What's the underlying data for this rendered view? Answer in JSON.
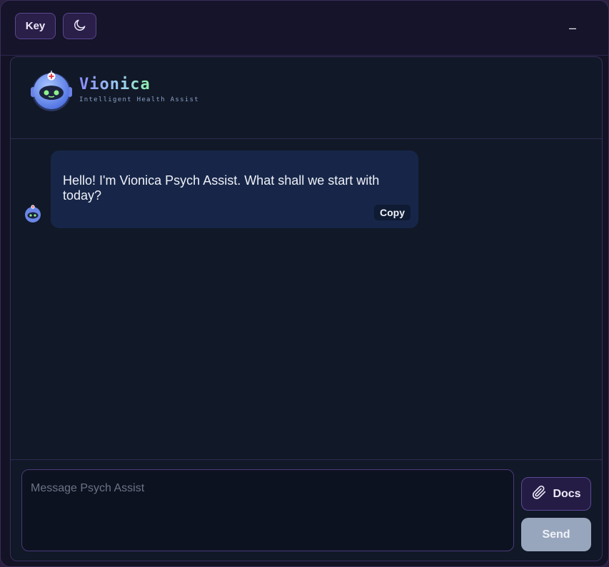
{
  "toolbar": {
    "key_label": "Key",
    "theme_icon": "moon-icon",
    "minimize_label": "–"
  },
  "brand": {
    "name": "Vionica",
    "tagline": "Intelligent Health Assist",
    "logo_icon": "robot-nurse-icon"
  },
  "messages": [
    {
      "sender": "assistant",
      "text": "Hello! I'm Vionica Psych Assist. What shall we start with today?",
      "copy_label": "Copy"
    }
  ],
  "composer": {
    "placeholder": "Message Psych Assist",
    "value": "",
    "docs_label": "Docs",
    "docs_icon": "paperclip-icon",
    "send_label": "Send"
  },
  "colors": {
    "accent": "#5a4790",
    "bubble": "#172648",
    "send_disabled": "#98a6bd"
  }
}
